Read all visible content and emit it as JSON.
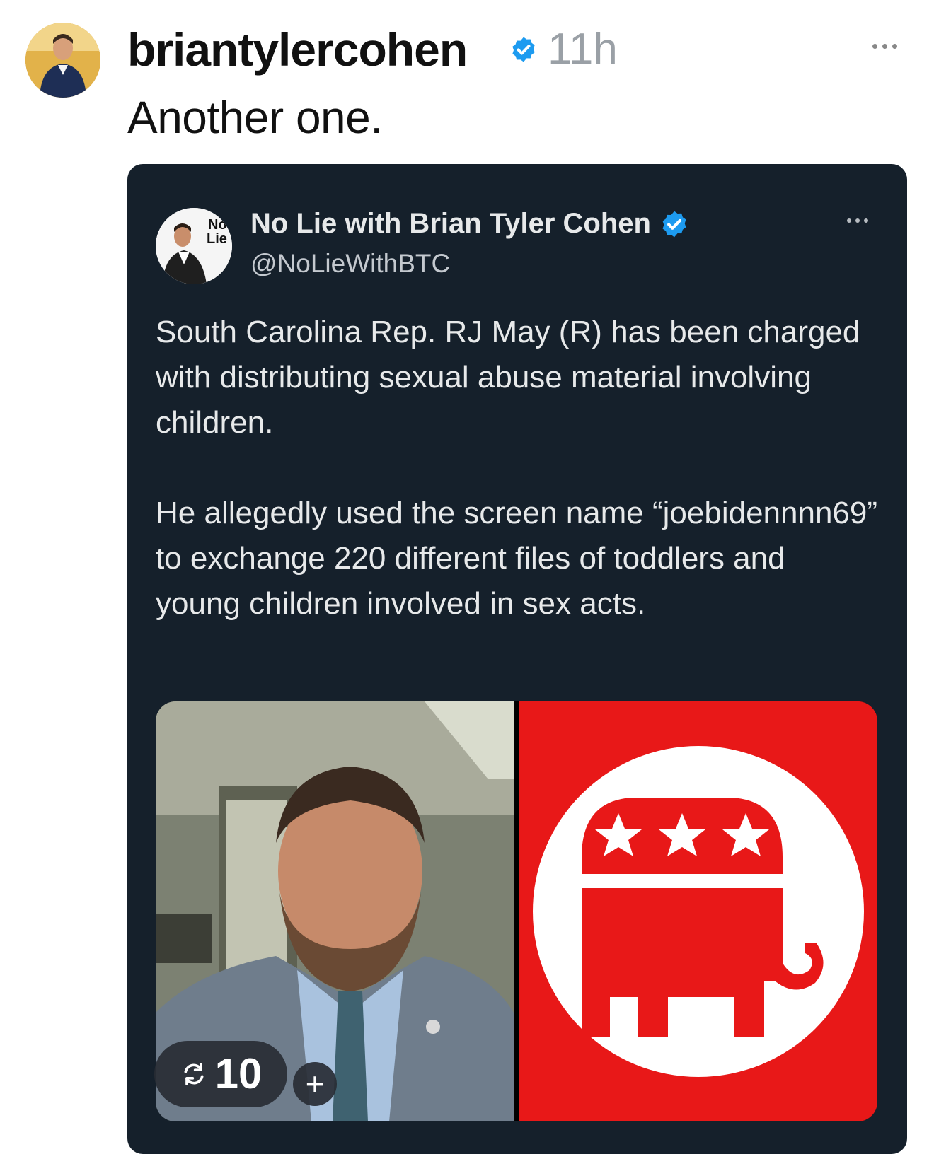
{
  "post": {
    "username": "briantylercohen",
    "time": "11h",
    "caption": "Another one."
  },
  "quoted": {
    "name": "No Lie with Brian Tyler Cohen",
    "handle": "@NoLieWithBTC",
    "paragraph1": "South Carolina Rep. RJ May (R) has been charged with distributing sexual abuse material involving children.",
    "paragraph2": "He allegedly used the screen name “joebidennnn69” to exchange 220 different files of toddlers and young children involved in sex acts."
  },
  "engagement": {
    "repost_count": "10",
    "plus_label": "+"
  },
  "images": {
    "left_icon": "person-photo",
    "right_icon": "republican-elephant-logo"
  },
  "colors": {
    "card_bg": "#15202b",
    "verified_blue": "#1d9bf0",
    "logo_red": "#e81818"
  }
}
